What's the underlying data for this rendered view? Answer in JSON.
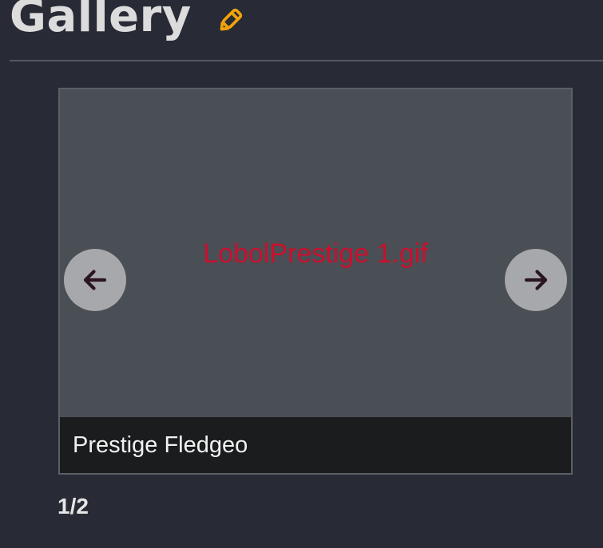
{
  "header": {
    "title": "Gallery",
    "edit_icon": "pencil-icon",
    "accent_color": "#f0a30a"
  },
  "gallery": {
    "image_alt": "LobolPrestige 1.gif",
    "caption": "Prestige Fledgeo",
    "prev_icon": "arrow-left-icon",
    "next_icon": "arrow-right-icon",
    "counter": "1/2",
    "alt_text_color": "#c8102e"
  }
}
